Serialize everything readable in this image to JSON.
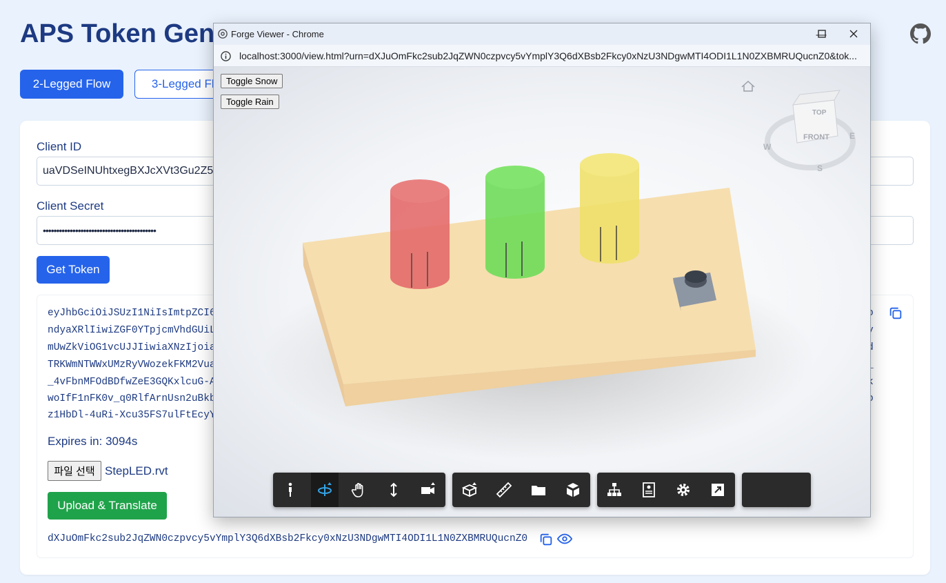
{
  "page": {
    "title": "APS Token Gene",
    "flows": [
      "2-Legged Flow",
      "3-Legged Flo"
    ]
  },
  "form": {
    "client_id_label": "Client ID",
    "client_id_value": "uaVDSeINUhtxegBXJcXVt3Gu2Z5I",
    "client_secret_label": "Client Secret",
    "client_secret_value": "••••••••••••••••••••••••••••••••••••••••••",
    "get_token_label": "Get Token"
  },
  "token": {
    "lines": [
      "eyJhbGciOiJSUzI1NiIsImtpZCI6",
      "ndyaXRlIiwiZGF0YTpjcmVhdGUiL",
      "mUwZkViOG1vcUJJIiwiaXNzIjoia",
      "TRKWmNTWWxUMzRyVWozekFKM2Vua",
      "_4vFbnMFOdBDfwZeE3GQKxlcuG-A",
      "woIfF1nFK0v_q0RlfArnUsn2uBkb",
      "z1HbDl-4uRi-Xcu35FS7ulFtEcyY"
    ],
    "tails": [
      "o",
      "y",
      "d",
      "_",
      "k",
      "o"
    ],
    "expires": "Expires in: 3094s"
  },
  "upload": {
    "file_button": "파일 선택",
    "file_name": "StepLED.rvt",
    "upload_label": "Upload & Translate",
    "urn": "dXJuOmFkc2sub2JqZWN0czpvcy5vYmplY3Q6dXBsb2Fkcy0xNzU3NDgwMTI4ODI1L1N0ZXBMRUQucnZ0"
  },
  "popup": {
    "window_title": "Forge Viewer - Chrome",
    "url": "localhost:3000/view.html?urn=dXJuOmFkc2sub2JqZWN0czpvcy5vYmplY3Q6dXBsb2Fkcy0xNzU3NDgwMTI4ODI1L1N0ZXBMRUQucnZ0&tok...",
    "toggle_snow": "Toggle Snow",
    "toggle_rain": "Toggle Rain",
    "viewcube": {
      "top": "TOP",
      "front": "FRONT",
      "w": "W",
      "e": "E",
      "s": "S"
    }
  },
  "colors": {
    "primary": "#2563eb",
    "success": "#1fa34a",
    "title": "#1d3a82",
    "board": "#f6deaf",
    "led_red": "#e46a6a",
    "led_green": "#6fdc5a",
    "led_yellow": "#f0e06a"
  },
  "icons": {
    "toolbar": [
      "walk-icon",
      "orbit-icon",
      "pan-icon",
      "dolly-icon",
      "camera-icon",
      "section-icon",
      "measure-icon",
      "model-browser-icon",
      "explode-icon",
      "structure-icon",
      "properties-icon",
      "settings-icon",
      "fullscreen-icon"
    ]
  }
}
